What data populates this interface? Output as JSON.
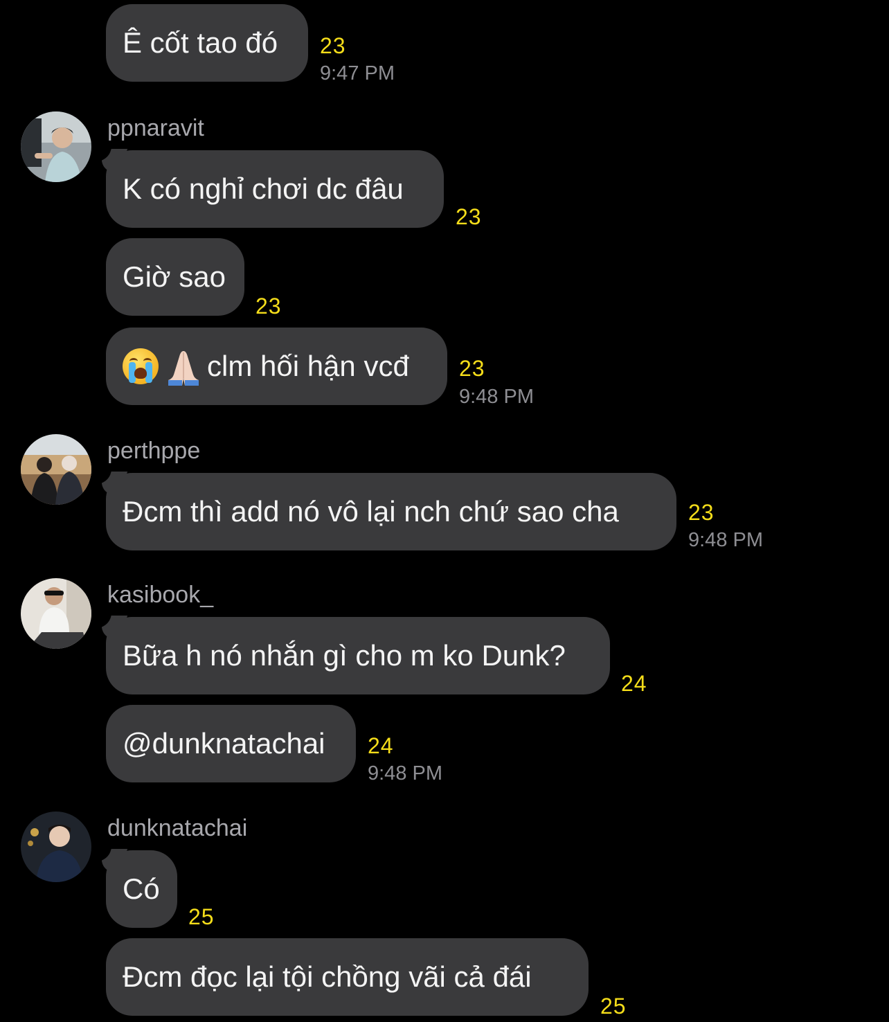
{
  "colors": {
    "background": "#000000",
    "bubble": "#3a3a3c",
    "count": "#f5dd1a",
    "timestamp": "#8e8e93",
    "sender": "#a8a8ad"
  },
  "messages": [
    {
      "text": "Ê cốt tao đó",
      "count": "23",
      "time": "9:47 PM"
    },
    {
      "sender": "ppnaravit",
      "avatar_icon": "person-avatar-icon"
    },
    {
      "text": "K có nghỉ chơi dc đâu",
      "count": "23"
    },
    {
      "text": "Giờ sao",
      "count": "23"
    },
    {
      "emoji": [
        "loudly-crying-face-icon",
        "folded-hands-icon"
      ],
      "text": "clm hối hận vcđ",
      "count": "23",
      "time": "9:48 PM"
    },
    {
      "sender": "perthppe",
      "avatar_icon": "couple-photo-avatar-icon"
    },
    {
      "text": "Đcm thì add nó vô lại nch chứ sao cha",
      "count": "23",
      "time": "9:48 PM"
    },
    {
      "sender": "kasibook_",
      "avatar_icon": "mirror-selfie-avatar-icon"
    },
    {
      "text": "Bữa h nó nhắn gì cho m ko Dunk?",
      "count": "24"
    },
    {
      "text": "@dunknatachai",
      "count": "24",
      "time": "9:48 PM"
    },
    {
      "sender": "dunknatachai",
      "avatar_icon": "portrait-avatar-icon"
    },
    {
      "text": "Có",
      "count": "25"
    },
    {
      "text": "Đcm đọc lại tội chồng vãi cả đái",
      "count": "25"
    }
  ]
}
